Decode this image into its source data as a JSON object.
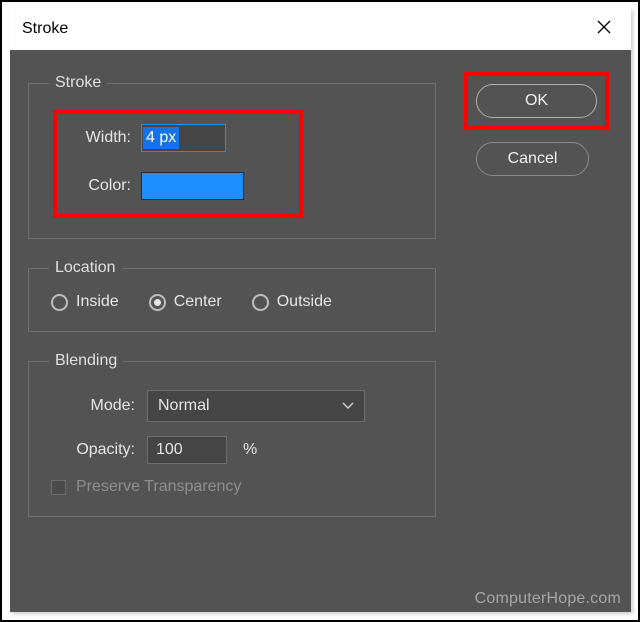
{
  "dialog": {
    "title": "Stroke"
  },
  "buttons": {
    "ok": "OK",
    "cancel": "Cancel"
  },
  "stroke": {
    "legend": "Stroke",
    "width_label": "Width:",
    "width_value": "4 px",
    "color_label": "Color:",
    "color_value": "#1e8fff"
  },
  "location": {
    "legend": "Location",
    "options": {
      "inside": "Inside",
      "center": "Center",
      "outside": "Outside"
    },
    "selected": "center"
  },
  "blending": {
    "legend": "Blending",
    "mode_label": "Mode:",
    "mode_value": "Normal",
    "opacity_label": "Opacity:",
    "opacity_value": "100",
    "opacity_unit": "%",
    "preserve_label": "Preserve Transparency",
    "preserve_checked": false
  },
  "watermark": "ComputerHope.com"
}
